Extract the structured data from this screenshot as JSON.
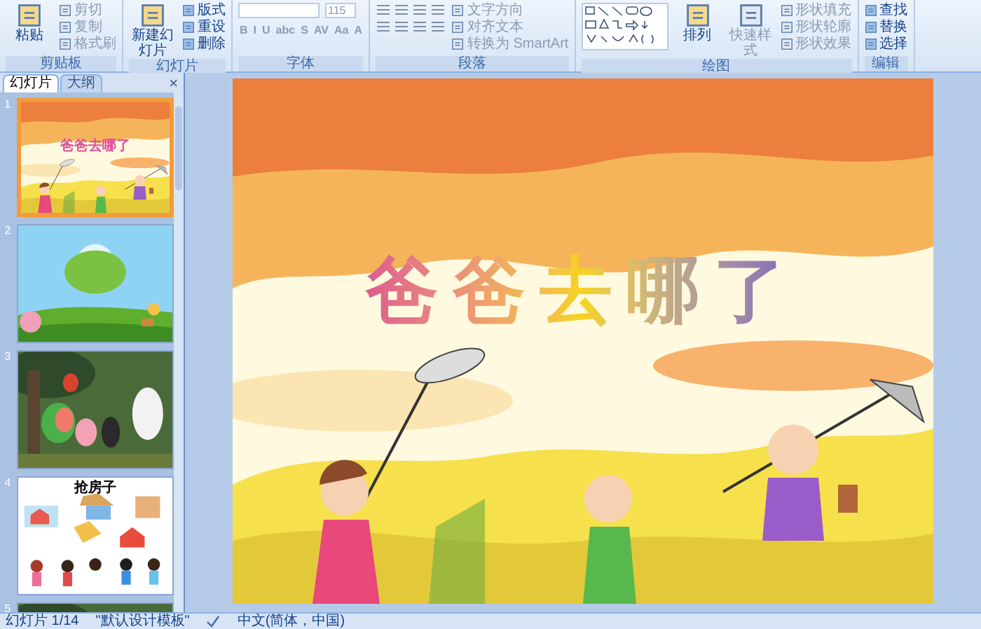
{
  "ribbon": {
    "groups": [
      {
        "kind": "buttons",
        "label": "剪贴板",
        "items": [
          {
            "kind": "large",
            "label": "粘贴",
            "disabled": false
          },
          {
            "kind": "small",
            "label": "剪切",
            "disabled": true
          },
          {
            "kind": "small",
            "label": "复制",
            "disabled": true
          },
          {
            "kind": "small",
            "label": "格式刷",
            "disabled": true
          }
        ]
      },
      {
        "kind": "buttons",
        "label": "幻灯片",
        "items": [
          {
            "kind": "large",
            "label": "新建幻灯片",
            "disabled": false
          },
          {
            "kind": "small",
            "label": "版式",
            "disabled": false
          },
          {
            "kind": "small",
            "label": "重设",
            "disabled": false
          },
          {
            "kind": "small",
            "label": "删除",
            "disabled": false
          }
        ]
      },
      {
        "kind": "font",
        "label": "字体",
        "font_size": "115",
        "format_buttons": [
          "B",
          "I",
          "U",
          "abc",
          "S",
          "AV",
          "Aa",
          "A"
        ]
      },
      {
        "kind": "paragraph",
        "label": "段落",
        "items": [
          {
            "kind": "small",
            "label": "文字方向",
            "disabled": true
          },
          {
            "kind": "small",
            "label": "对齐文本",
            "disabled": true
          },
          {
            "kind": "small",
            "label": "转换为 SmartArt",
            "disabled": true
          }
        ]
      },
      {
        "kind": "drawing",
        "label": "绘图",
        "items": [
          {
            "kind": "large",
            "label": "排列",
            "disabled": false
          },
          {
            "kind": "large",
            "label": "快速样式",
            "disabled": true
          },
          {
            "kind": "small",
            "label": "形状填充",
            "disabled": true
          },
          {
            "kind": "small",
            "label": "形状轮廓",
            "disabled": true
          },
          {
            "kind": "small",
            "label": "形状效果",
            "disabled": true
          }
        ]
      },
      {
        "kind": "buttons",
        "label": "编辑",
        "items": [
          {
            "kind": "small",
            "label": "查找",
            "disabled": false
          },
          {
            "kind": "small",
            "label": "替换",
            "disabled": false
          },
          {
            "kind": "small",
            "label": "选择",
            "disabled": false
          }
        ]
      }
    ]
  },
  "panel": {
    "tabs": [
      {
        "label": "幻灯片",
        "selected": true
      },
      {
        "label": "大纲",
        "selected": false
      }
    ],
    "close": "×",
    "slides": [
      {
        "number": "1",
        "kind": "field",
        "title": "爸爸去哪了",
        "selected": true
      },
      {
        "number": "2",
        "kind": "hill",
        "selected": false
      },
      {
        "number": "3",
        "kind": "forest",
        "selected": false
      },
      {
        "number": "4",
        "kind": "houses",
        "title": "抢房子",
        "selected": false
      },
      {
        "number": "5",
        "kind": "forest",
        "selected": false
      }
    ]
  },
  "slide": {
    "title": "爸爸去哪了"
  },
  "status_bar": {
    "slide": "幻灯片 1/14",
    "theme": "\"默认设计模板\"",
    "language": "中文(简体，中国)"
  }
}
